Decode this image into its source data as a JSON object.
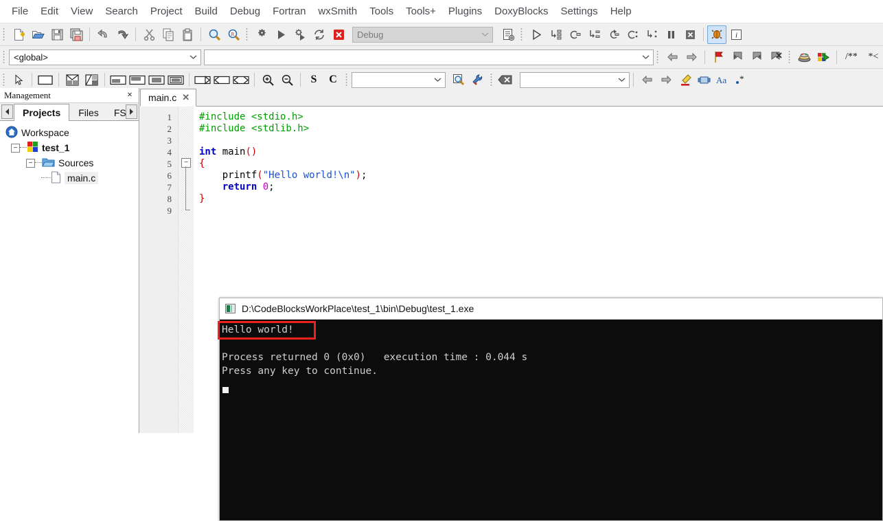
{
  "menubar": {
    "items": [
      {
        "label": "File",
        "name": "menu-file"
      },
      {
        "label": "Edit",
        "name": "menu-edit"
      },
      {
        "label": "View",
        "name": "menu-view"
      },
      {
        "label": "Search",
        "name": "menu-search"
      },
      {
        "label": "Project",
        "name": "menu-project"
      },
      {
        "label": "Build",
        "name": "menu-build"
      },
      {
        "label": "Debug",
        "name": "menu-debug"
      },
      {
        "label": "Fortran",
        "name": "menu-fortran"
      },
      {
        "label": "wxSmith",
        "name": "menu-wxsmith"
      },
      {
        "label": "Tools",
        "name": "menu-tools"
      },
      {
        "label": "Tools+",
        "name": "menu-tools-plus"
      },
      {
        "label": "Plugins",
        "name": "menu-plugins"
      },
      {
        "label": "DoxyBlocks",
        "name": "menu-doxyblocks"
      },
      {
        "label": "Settings",
        "name": "menu-settings"
      },
      {
        "label": "Help",
        "name": "menu-help"
      }
    ]
  },
  "toolbars": {
    "main_icons": [
      "new-file-icon",
      "open-file-icon",
      "save-icon",
      "save-all-icon",
      "undo-icon",
      "redo-icon",
      "cut-icon",
      "copy-icon",
      "paste-icon",
      "find-icon",
      "replace-icon"
    ],
    "build_icons": [
      "build-icon",
      "run-icon",
      "build-and-run-icon",
      "rebuild-icon",
      "abort-icon"
    ],
    "build_target": {
      "value": "Debug",
      "name": "build-target-combo",
      "enabled": false
    },
    "build_extra_icon": "build-options-icon",
    "debug_icons": [
      "debug-continue-icon",
      "debug-run-to-cursor-icon",
      "debug-next-line-icon",
      "debug-step-into-icon",
      "debug-step-out-icon",
      "debug-next-instruction-icon",
      "debug-step-into-instruction-icon",
      "debug-break-icon",
      "debug-stop-icon",
      "debug-info-icon",
      "debug-various-info-icon"
    ],
    "scope": {
      "value": "<global>",
      "name": "scope-combo"
    },
    "symbol": {
      "value": "",
      "name": "symbol-combo"
    },
    "nav_icons": [
      "back-icon",
      "forward-icon",
      "toggle-bookmark-icon",
      "previous-bookmark-icon",
      "next-bookmark-icon",
      "clear-bookmarks-icon"
    ],
    "doxy_icons": [
      "doxyblocks-run-icon",
      "doxyblocks-extract-icon"
    ],
    "doxy_text": [
      "/**",
      "*<"
    ],
    "wxsmith_icons": [
      "pointer-icon",
      "panel-icon",
      "grid-sizer-icon",
      "flex-grid-sizer-icon",
      "box-sizer-h-icon",
      "box-sizer-v-icon",
      "static-box-sizer-icon",
      "std-dialog-sizer-icon",
      "spacer-icon",
      "stretch-spacer-icon",
      "custom-spacer-icon"
    ],
    "zoom_icons": [
      "zoom-in-icon",
      "zoom-out-icon"
    ],
    "letter_buttons": [
      "S",
      "C"
    ],
    "search_box": {
      "value": "",
      "name": "search-combo"
    },
    "search_icons": [
      "search-go-icon",
      "search-options-icon",
      "clear-search-icon"
    ],
    "incr_search": {
      "value": "",
      "name": "incremental-search-combo"
    },
    "incr_icons": [
      "prev-match-icon",
      "next-match-icon",
      "highlight-icon",
      "select-all-matches-icon",
      "match-case-icon",
      "regex-icon"
    ]
  },
  "management": {
    "title": "Management",
    "close": "×",
    "tabs": [
      {
        "label": "Projects",
        "name": "panel-tab-projects",
        "active": true
      },
      {
        "label": "Files",
        "name": "panel-tab-files",
        "active": false
      },
      {
        "label": "FSymbols",
        "name": "panel-tab-fsymbols",
        "active": false
      }
    ],
    "tree": {
      "workspace": "Workspace",
      "project": "test_1",
      "group": "Sources",
      "file": "main.c"
    }
  },
  "editor": {
    "tab": {
      "label": "main.c",
      "close": "✕",
      "name": "editor-tab-main-c"
    },
    "line_numbers": [
      "1",
      "2",
      "3",
      "4",
      "5",
      "6",
      "7",
      "8",
      "9"
    ],
    "code_lines": [
      "#include <stdio.h>",
      "#include <stdlib.h>",
      "",
      "int main()",
      "{",
      "    printf(\"Hello world!\\n\");",
      "    return 0;",
      "}",
      ""
    ]
  },
  "console": {
    "title": "D:\\CodeBlocksWorkPlace\\test_1\\bin\\Debug\\test_1.exe",
    "icon": "console-window-icon",
    "output_lines": [
      "Hello world!",
      "",
      "Process returned 0 (0x0)   execution time : 0.044 s",
      "Press any key to continue."
    ],
    "highlight_color": "#ef2020",
    "background": "#0c0c0c",
    "text_color": "#cfcfcf"
  },
  "colors": {
    "toolbar_bg": "#f0f0f0",
    "accent_blue": "#0000c0",
    "string_blue": "#1a4fd6",
    "preproc_green": "#00a000",
    "brace_red": "#cc0000",
    "number_magenta": "#cc00cc"
  }
}
